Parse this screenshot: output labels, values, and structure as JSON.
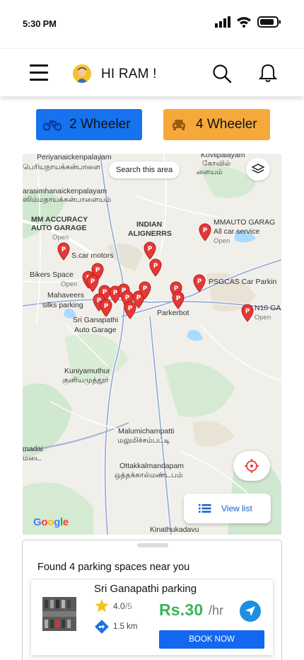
{
  "status_bar": {
    "time": "5:30 PM"
  },
  "header": {
    "greeting": "HI RAM !"
  },
  "vehicle_toggle": [
    {
      "label": "2 Wheeler",
      "color": "#1673f0",
      "icon": "motorbike-icon"
    },
    {
      "label": "4 Wheeler",
      "color": "#f6a93b",
      "icon": "car-icon"
    }
  ],
  "map": {
    "search_area_label": "Search this area",
    "view_list_label": "View list",
    "attribution": "Google",
    "places": [
      "Periyanaickenpalayam",
      "பெரியநாயக்கன்பாளை",
      "Kovilpalayam",
      "கோவில்",
      "ளையம்",
      "arasimhanaickenpalayam",
      "ஸிம்மநாயக்கன்பாளையம்",
      "MM ACCURACY",
      "AUTO GARAGE",
      "Open",
      "INDIAN",
      "ALIGNERRS",
      "MMAUTO GARAG",
      "All car service",
      "Open",
      "S.car motors",
      "Bikers Space",
      "Open",
      "PSGCAS Car Parkin",
      "Mahaveers",
      "silks parking",
      "N10 GA",
      "Open",
      "Sri Ganapathi",
      "Auto Garage",
      "Parkerbot",
      "Kuniyamuthur",
      "குனியமுத்தூர்",
      "Malumichampatti",
      "மலுமிச்சம்பட்டி",
      "madai",
      "மடை",
      "Ottakkalmandapam",
      "ஒத்தக்கால்மண்டபம்",
      "Kinathukadavu"
    ]
  },
  "results": {
    "found_text": "Found 4 parking spaces near you",
    "card": {
      "name": "Sri Ganapathi parking",
      "rating": "4.0",
      "rating_max": "/5",
      "distance": "1.5 km",
      "price": "Rs.30",
      "unit": "/hr",
      "book_label": "BOOK NOW"
    }
  },
  "colors": {
    "primary": "#1467f0",
    "accent_orange": "#f6a93b",
    "price_green": "#3bb35a",
    "pin_red": "#e53935"
  }
}
